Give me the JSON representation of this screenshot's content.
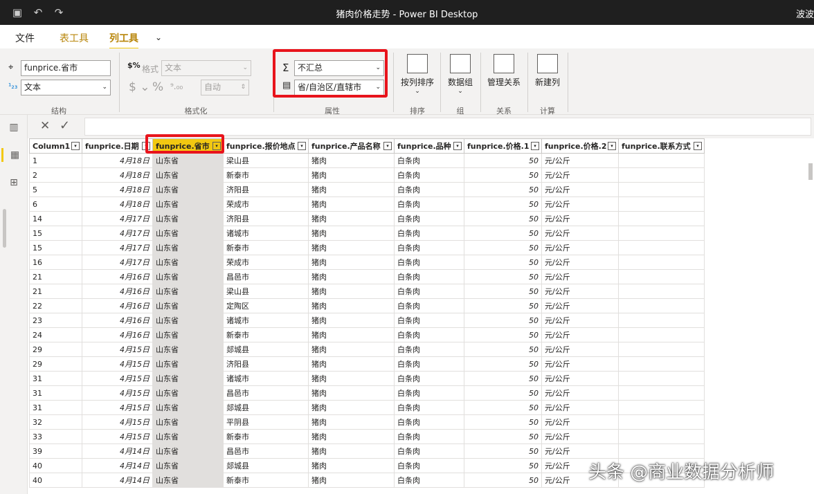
{
  "window": {
    "title": "猪肉价格走势 - Power BI Desktop",
    "user": "波波"
  },
  "tabs": [
    {
      "label": "文件"
    },
    {
      "label": "表工具"
    },
    {
      "label": "列工具"
    }
  ],
  "structure": {
    "name_value": "funprice.省市",
    "type_value": "文本",
    "group_label": "结构"
  },
  "format": {
    "format_label": "格式",
    "format_value": "文本",
    "auto_value": "自动",
    "group_label": "格式化"
  },
  "properties": {
    "summarize_value": "不汇总",
    "category_value": "省/自治区/直辖市",
    "group_label": "属性"
  },
  "sort": {
    "button_label": "按列排序",
    "group_label": "排序"
  },
  "groups": {
    "button_label": "数据组",
    "group_label": "组"
  },
  "relations": {
    "button_label": "管理关系",
    "group_label": "关系"
  },
  "calc": {
    "button_label": "新建列",
    "group_label": "计算"
  },
  "table": {
    "columns": [
      "Column1",
      "funprice.日期",
      "funprice.省市",
      "funprice.报价地点",
      "funprice.产品名称",
      "funprice.品种",
      "funprice.价格.1",
      "funprice.价格.2",
      "funprice.联系方式"
    ],
    "rows": [
      [
        "1",
        "4月18日",
        "山东省",
        "梁山县",
        "猪肉",
        "白条肉",
        "50",
        "元/公斤",
        ""
      ],
      [
        "2",
        "4月18日",
        "山东省",
        "新泰市",
        "猪肉",
        "白条肉",
        "50",
        "元/公斤",
        ""
      ],
      [
        "5",
        "4月18日",
        "山东省",
        "济阳县",
        "猪肉",
        "白条肉",
        "50",
        "元/公斤",
        ""
      ],
      [
        "6",
        "4月18日",
        "山东省",
        "荣成市",
        "猪肉",
        "白条肉",
        "50",
        "元/公斤",
        ""
      ],
      [
        "14",
        "4月17日",
        "山东省",
        "济阳县",
        "猪肉",
        "白条肉",
        "50",
        "元/公斤",
        ""
      ],
      [
        "15",
        "4月17日",
        "山东省",
        "诸城市",
        "猪肉",
        "白条肉",
        "50",
        "元/公斤",
        ""
      ],
      [
        "15",
        "4月17日",
        "山东省",
        "新泰市",
        "猪肉",
        "白条肉",
        "50",
        "元/公斤",
        ""
      ],
      [
        "16",
        "4月17日",
        "山东省",
        "荣成市",
        "猪肉",
        "白条肉",
        "50",
        "元/公斤",
        ""
      ],
      [
        "21",
        "4月16日",
        "山东省",
        "昌邑市",
        "猪肉",
        "白条肉",
        "50",
        "元/公斤",
        ""
      ],
      [
        "21",
        "4月16日",
        "山东省",
        "梁山县",
        "猪肉",
        "白条肉",
        "50",
        "元/公斤",
        ""
      ],
      [
        "22",
        "4月16日",
        "山东省",
        "定陶区",
        "猪肉",
        "白条肉",
        "50",
        "元/公斤",
        ""
      ],
      [
        "23",
        "4月16日",
        "山东省",
        "诸城市",
        "猪肉",
        "白条肉",
        "50",
        "元/公斤",
        ""
      ],
      [
        "24",
        "4月16日",
        "山东省",
        "新泰市",
        "猪肉",
        "白条肉",
        "50",
        "元/公斤",
        ""
      ],
      [
        "29",
        "4月15日",
        "山东省",
        "郯城县",
        "猪肉",
        "白条肉",
        "50",
        "元/公斤",
        ""
      ],
      [
        "29",
        "4月15日",
        "山东省",
        "济阳县",
        "猪肉",
        "白条肉",
        "50",
        "元/公斤",
        ""
      ],
      [
        "31",
        "4月15日",
        "山东省",
        "诸城市",
        "猪肉",
        "白条肉",
        "50",
        "元/公斤",
        ""
      ],
      [
        "31",
        "4月15日",
        "山东省",
        "昌邑市",
        "猪肉",
        "白条肉",
        "50",
        "元/公斤",
        ""
      ],
      [
        "31",
        "4月15日",
        "山东省",
        "郯城县",
        "猪肉",
        "白条肉",
        "50",
        "元/公斤",
        ""
      ],
      [
        "32",
        "4月15日",
        "山东省",
        "平阴县",
        "猪肉",
        "白条肉",
        "50",
        "元/公斤",
        ""
      ],
      [
        "33",
        "4月15日",
        "山东省",
        "新泰市",
        "猪肉",
        "白条肉",
        "50",
        "元/公斤",
        ""
      ],
      [
        "39",
        "4月14日",
        "山东省",
        "昌邑市",
        "猪肉",
        "白条肉",
        "50",
        "元/公斤",
        ""
      ],
      [
        "40",
        "4月14日",
        "山东省",
        "郯城县",
        "猪肉",
        "白条肉",
        "50",
        "元/公斤",
        ""
      ],
      [
        "40",
        "4月14日",
        "山东省",
        "新泰市",
        "猪肉",
        "白条肉",
        "50",
        "元/公斤",
        ""
      ]
    ]
  },
  "watermark": "头条 @商业数据分析师"
}
